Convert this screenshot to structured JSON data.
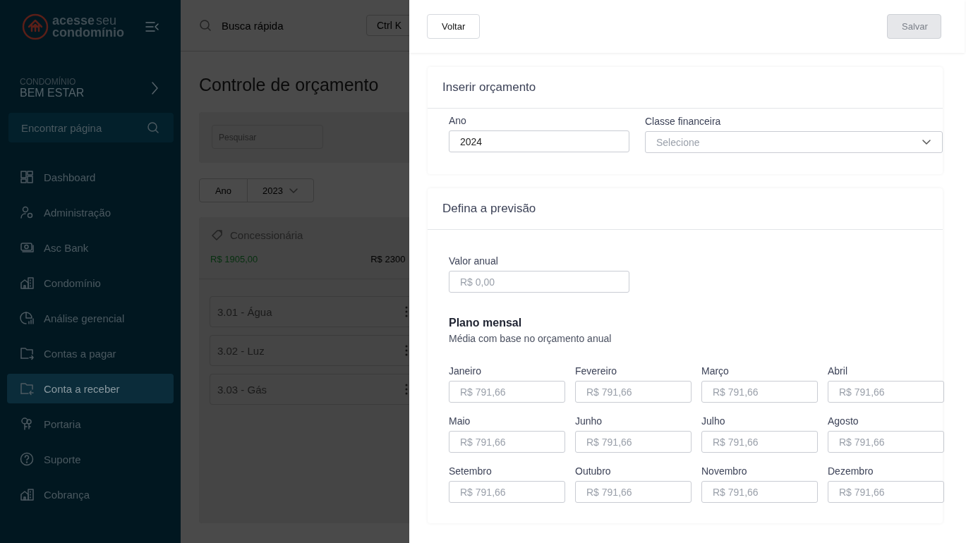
{
  "sidebar": {
    "logo": {
      "word_1": "acesse",
      "word_2": "seu",
      "word_3": "condomínio"
    },
    "condo": {
      "label": "CONDOMÍNIO",
      "name": "BEM ESTAR"
    },
    "search": {
      "placeholder": "Encontrar página"
    },
    "items": [
      {
        "label": "Dashboard",
        "selected": false
      },
      {
        "label": "Administração",
        "selected": false
      },
      {
        "label": "Asc Bank",
        "selected": false
      },
      {
        "label": "Condomínio",
        "selected": false
      },
      {
        "label": "Análise gerencial",
        "selected": false
      },
      {
        "label": "Contas a pagar",
        "selected": false
      },
      {
        "label": "Conta a receber",
        "selected": true
      },
      {
        "label": "Portaria",
        "selected": false
      },
      {
        "label": "Suporte",
        "selected": false
      },
      {
        "label": "Cobrança",
        "selected": false
      }
    ]
  },
  "main": {
    "quick_search": {
      "placeholder": "Busca rápida",
      "shortcut": "Ctrl K"
    },
    "title": "Controle de orçamento",
    "filter": {
      "placeholder": "Pesquisar"
    },
    "year_filter": {
      "label": "Ano",
      "value": "2023"
    },
    "group": {
      "title": "Concessionária",
      "amount_1": "R$ 1905,00",
      "amount_2": "R$ 2300",
      "items": [
        {
          "label": "3.01 - Água"
        },
        {
          "label": "3.02 - Luz"
        },
        {
          "label": "3.03 - Gás"
        }
      ]
    }
  },
  "panel": {
    "back_button": {
      "label": "Voltar"
    },
    "save_button": {
      "label": "Salvar",
      "disabled": true
    },
    "insert_section": {
      "title": "Inserir orçamento",
      "year": {
        "label": "Ano",
        "value": "2024"
      },
      "financial_class": {
        "label": "Classe financeira",
        "placeholder": "Selecione"
      }
    },
    "forecast_section": {
      "title": "Defina a previsão",
      "annual_value": {
        "label": "Valor anual",
        "placeholder": "R$ 0,00"
      },
      "monthly_plan": {
        "title": "Plano mensal",
        "subtitle": "Média com base no orçamento anual",
        "months": [
          {
            "label": "Janeiro",
            "placeholder": "R$ 791,66"
          },
          {
            "label": "Fevereiro",
            "placeholder": "R$ 791,66"
          },
          {
            "label": "Março",
            "placeholder": "R$ 791,66"
          },
          {
            "label": "Abril",
            "placeholder": "R$ 791,66"
          },
          {
            "label": "Maio",
            "placeholder": "R$ 791,66"
          },
          {
            "label": "Junho",
            "placeholder": "R$ 791,66"
          },
          {
            "label": "Julho",
            "placeholder": "R$ 791,66"
          },
          {
            "label": "Agosto",
            "placeholder": "R$ 791,66"
          },
          {
            "label": "Setembro",
            "placeholder": "R$ 791,66"
          },
          {
            "label": "Outubro",
            "placeholder": "R$ 791,66"
          },
          {
            "label": "Novembro",
            "placeholder": "R$ 791,66"
          },
          {
            "label": "Dezembro",
            "placeholder": "R$ 791,66"
          }
        ]
      }
    }
  }
}
